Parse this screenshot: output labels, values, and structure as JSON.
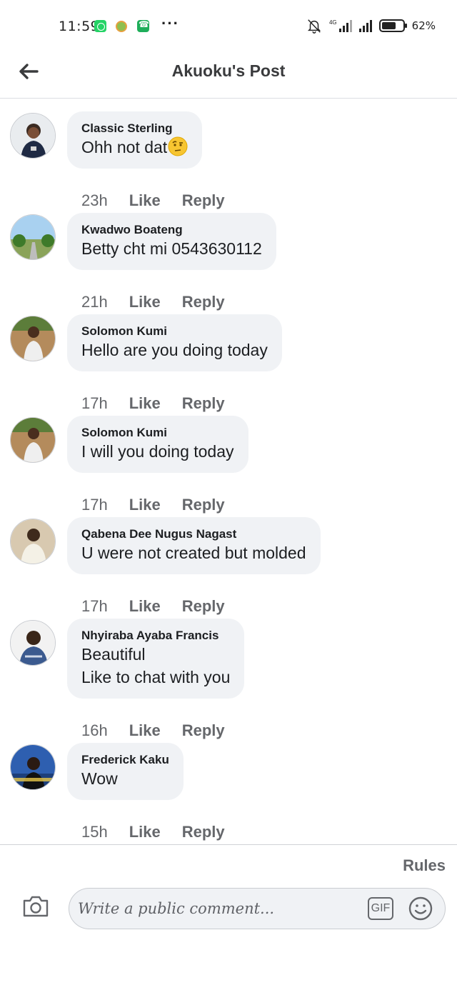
{
  "status_bar": {
    "time": "11:59",
    "network": "4G",
    "battery_percent": "62%",
    "battery_level": 0.62,
    "icons": [
      "whatsapp-icon",
      "app-circle-icon",
      "phone-app-icon",
      "more-dots-icon",
      "bell-muted-icon",
      "signal-icon",
      "signal-icon",
      "battery-icon"
    ]
  },
  "header": {
    "title": "Akuoku's Post",
    "back_icon": "back-arrow-icon"
  },
  "comments": [
    {
      "name": "Classic Sterling",
      "lines": [
        "Ohh not dat"
      ],
      "emoji": "raised-eyebrow-emoji",
      "time": "23h",
      "like": "Like",
      "reply": "Reply"
    },
    {
      "name": "Kwadwo Boateng",
      "lines": [
        "Betty cht mi 0543630112"
      ],
      "time": "21h",
      "like": "Like",
      "reply": "Reply"
    },
    {
      "name": "Solomon Kumi",
      "lines": [
        "Hello are you doing today"
      ],
      "time": "17h",
      "like": "Like",
      "reply": "Reply"
    },
    {
      "name": "Solomon Kumi",
      "lines": [
        "I will you doing today"
      ],
      "time": "17h",
      "like": "Like",
      "reply": "Reply"
    },
    {
      "name": "Qabena Dee Nugus Nagast",
      "lines": [
        "U were not created but molded"
      ],
      "time": "17h",
      "like": "Like",
      "reply": "Reply"
    },
    {
      "name": "Nhyiraba Ayaba Francis",
      "lines": [
        "Beautiful",
        "Like to chat with you"
      ],
      "time": "16h",
      "like": "Like",
      "reply": "Reply"
    },
    {
      "name": "Frederick Kaku",
      "lines": [
        "Wow"
      ],
      "time": "15h",
      "like": "Like",
      "reply": "Reply"
    }
  ],
  "composer": {
    "rules_label": "Rules",
    "placeholder": "Write a public comment...",
    "gif_label": "GIF",
    "camera_icon": "camera-icon",
    "emoji_icon": "emoji-icon"
  },
  "colors": {
    "bubble_bg": "#f0f2f5",
    "secondary_text": "#65676b",
    "primary_text": "#1c1e21"
  }
}
